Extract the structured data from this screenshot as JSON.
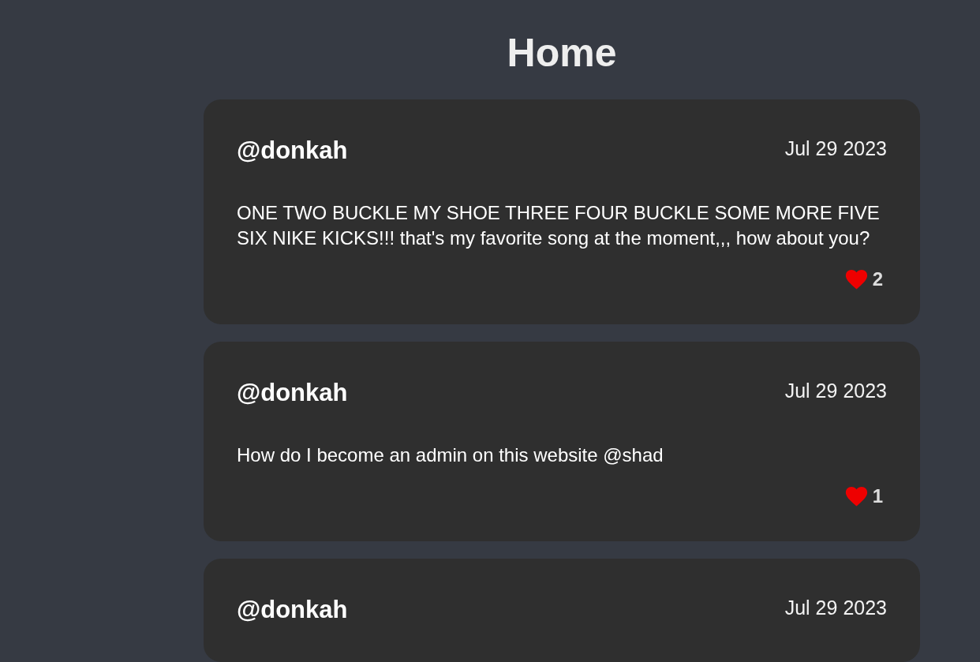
{
  "page": {
    "title": "Home"
  },
  "posts": [
    {
      "author": "@donkah",
      "date": "Jul 29 2023",
      "body": "ONE TWO BUCKLE MY SHOE THREE FOUR BUCKLE SOME MORE FIVE SIX NIKE KICKS!!! that's my favorite song at the moment,,, how about you?",
      "likes": "2"
    },
    {
      "author": "@donkah",
      "date": "Jul 29 2023",
      "body": "How do I become an admin on this website @shad",
      "likes": "1"
    },
    {
      "author": "@donkah",
      "date": "Jul 29 2023"
    }
  ]
}
